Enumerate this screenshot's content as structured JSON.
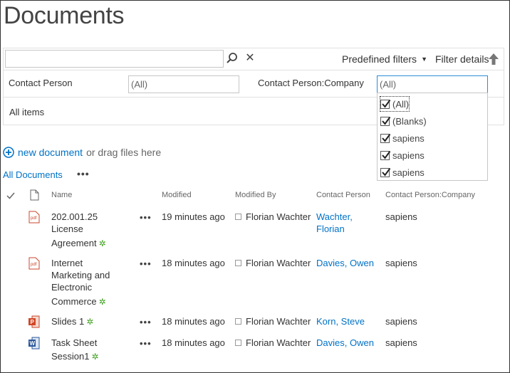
{
  "page": {
    "title": "Documents"
  },
  "toolbar": {
    "search_value": "",
    "predefined_label": "Predefined filters",
    "filter_details_label": "Filter details"
  },
  "filters": {
    "contact_person_label": "Contact Person",
    "contact_person_value": "(All)",
    "company_label": "Contact Person:Company",
    "company_value": "(All)",
    "items_label": "All items"
  },
  "dropdown": {
    "options": [
      "(All)",
      "(Blanks)",
      "sapiens",
      "sapiens",
      "sapiens"
    ]
  },
  "commands": {
    "new_document": "new document",
    "drag_text": "or drag files here",
    "view_name": "All Documents",
    "view_more": "•••"
  },
  "table": {
    "headers": {
      "name": "Name",
      "modified": "Modified",
      "modified_by": "Modified By",
      "contact_person": "Contact Person",
      "company": "Contact Person:Company"
    },
    "rows": [
      {
        "icon": "pdf-icon",
        "name_lines": [
          "202.001.25",
          "License",
          "Agreement"
        ],
        "modified": "19 minutes ago",
        "modified_by": "Florian Wachter",
        "contact_lines": [
          "Wachter,",
          "Florian"
        ],
        "company": "sapiens"
      },
      {
        "icon": "pdf-icon",
        "name_lines": [
          "Internet",
          "Marketing and",
          "Electronic",
          "Commerce"
        ],
        "modified": "18 minutes ago",
        "modified_by": "Florian Wachter",
        "contact_lines": [
          "Davies, Owen"
        ],
        "company": "sapiens"
      },
      {
        "icon": "powerpoint-icon",
        "name_lines": [
          "Slides 1"
        ],
        "modified": "18 minutes ago",
        "modified_by": "Florian Wachter",
        "contact_lines": [
          "Korn, Steve"
        ],
        "company": "sapiens"
      },
      {
        "icon": "word-icon",
        "name_lines": [
          "Task Sheet",
          "Session1"
        ],
        "modified": "18 minutes ago",
        "modified_by": "Florian Wachter",
        "contact_lines": [
          "Davies, Owen"
        ],
        "company": "sapiens"
      }
    ],
    "row_more": "•••",
    "new_badge": "✲"
  },
  "colors": {
    "accent": "#0072c6",
    "new_badge": "#40a020",
    "focus_border": "#2a8dd4"
  }
}
